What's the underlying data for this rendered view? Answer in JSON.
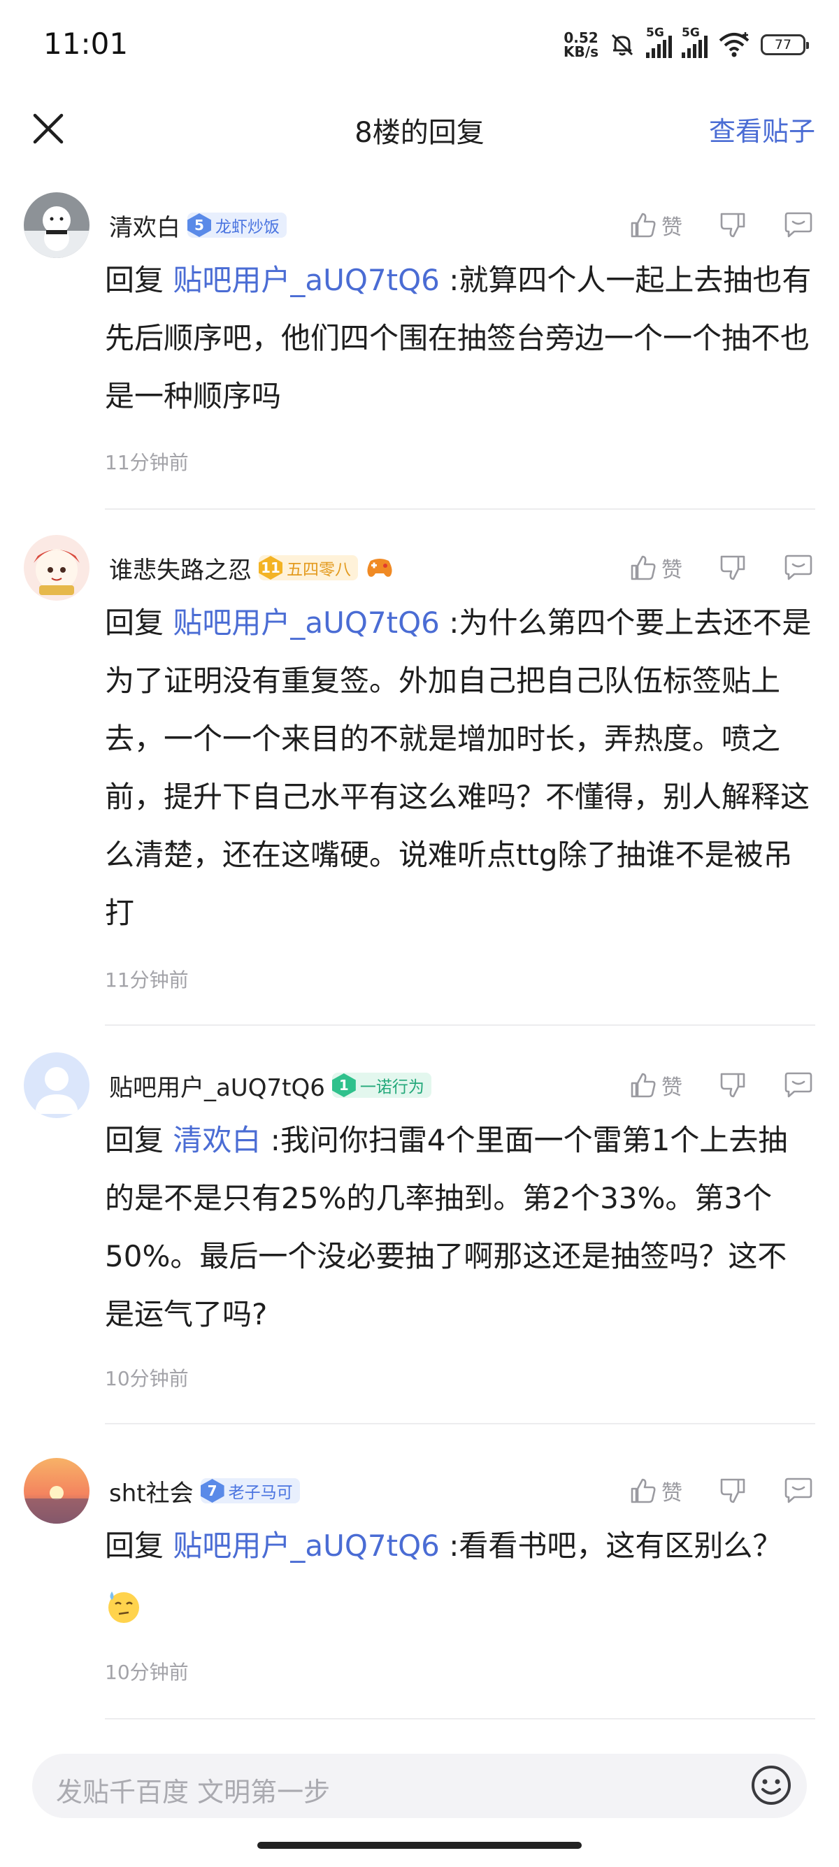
{
  "status": {
    "time": "11:01",
    "net_speed_value": "0.52",
    "net_speed_unit": "KB/s",
    "sim1": "5G",
    "sim2": "5G",
    "battery": "77"
  },
  "nav": {
    "title": "8楼的回复",
    "view_post": "查看贴子"
  },
  "replies": [
    {
      "username": "清欢白",
      "level": "5",
      "badge": "龙虾炒饭",
      "reply_prefix": "回复",
      "mention": "贴吧用户_aUQ7tQ6",
      "text": " :就算四个人一起上去抽也有先后顺序吧，他们四个围在抽签台旁边一个一个抽不也是一种顺序吗",
      "time": "11分钟前",
      "like_label": "赞"
    },
    {
      "username": "谁悲失路之忍",
      "level": "11",
      "badge": "五四零八",
      "reply_prefix": "回复",
      "mention": "贴吧用户_aUQ7tQ6",
      "text": " :为什么第四个要上去还不是为了证明没有重复签。外加自己把自己队伍标签贴上去，一个一个来目的不就是增加时长，弄热度。喷之前，提升下自己水平有这么难吗？不懂得，别人解释这么清楚，还在这嘴硬。说难听点ttg除了抽谁不是被吊打",
      "time": "11分钟前",
      "like_label": "赞"
    },
    {
      "username": "贴吧用户_aUQ7tQ6",
      "level": "1",
      "badge": "一诺行为",
      "reply_prefix": "回复",
      "mention": "清欢白",
      "text": " :我问你扫雷4个里面一个雷第1个上去抽的是不是只有25%的几率抽到。第2个33%。第3个50%。最后一个没必要抽了啊那这还是抽签吗？这不是运气了吗?",
      "time": "10分钟前",
      "like_label": "赞"
    },
    {
      "username": "sht社会",
      "level": "7",
      "badge": "老子马可",
      "reply_prefix": "回复",
      "mention": "贴吧用户_aUQ7tQ6",
      "text": " :看看书吧，这有区别么？",
      "time": "10分钟前",
      "like_label": "赞"
    }
  ],
  "input": {
    "placeholder": "发贴千百度 文明第一步"
  },
  "colors": {
    "link": "#4a6cd4",
    "text": "#1e1e1e",
    "muted": "#a3a3a8"
  }
}
